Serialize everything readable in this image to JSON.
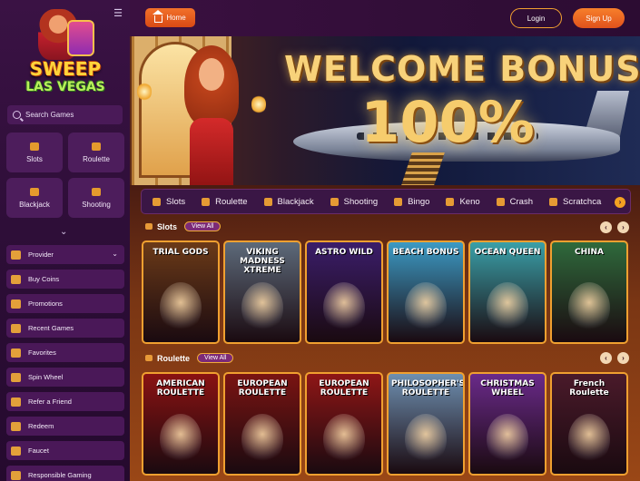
{
  "brand": {
    "line1": "SWEEP",
    "line2": "LAS VEGAS"
  },
  "sidebar": {
    "search_placeholder": "Search Games",
    "tiles": [
      {
        "label": "Slots",
        "icon": "slot-machine-icon"
      },
      {
        "label": "Roulette",
        "icon": "roulette-icon"
      },
      {
        "label": "Blackjack",
        "icon": "cards-icon"
      },
      {
        "label": "Shooting",
        "icon": "target-icon"
      }
    ],
    "nav": [
      {
        "label": "Provider",
        "icon": "provider-icon"
      },
      {
        "label": "Buy Coins",
        "icon": "coins-icon"
      },
      {
        "label": "Promotions",
        "icon": "gift-icon"
      },
      {
        "label": "Recent Games",
        "icon": "history-icon"
      },
      {
        "label": "Favorites",
        "icon": "star-icon"
      },
      {
        "label": "Spin Wheel",
        "icon": "wheel-icon"
      },
      {
        "label": "Refer a Friend",
        "icon": "users-icon"
      },
      {
        "label": "Redeem",
        "icon": "redeem-icon"
      },
      {
        "label": "Faucet",
        "icon": "faucet-icon"
      },
      {
        "label": "Responsible Gaming",
        "icon": "shield-icon"
      }
    ]
  },
  "header": {
    "home_label": "Home",
    "login_label": "Login",
    "signup_label": "Sign Up"
  },
  "banner": {
    "headline": "WELCOME BONUS",
    "percent": "100%"
  },
  "categories": [
    "Slots",
    "Roulette",
    "Blackjack",
    "Shooting",
    "Bingo",
    "Keno",
    "Crash",
    "Scratchca"
  ],
  "sections": {
    "slots": {
      "title": "Slots",
      "view_all": "View All",
      "games": [
        {
          "title": "TRIAL GODS",
          "bg": "#6b3a18"
        },
        {
          "title": "VIKING MADNESS XTREME",
          "bg": "#5d6a7a"
        },
        {
          "title": "ASTRO WILD",
          "bg": "#3b1d6a"
        },
        {
          "title": "BEACH BONUS",
          "bg": "#3c9ac4"
        },
        {
          "title": "OCEAN QUEEN",
          "bg": "#3aa0a8"
        },
        {
          "title": "CHINA",
          "bg": "#2f6a3c"
        }
      ]
    },
    "roulette": {
      "title": "Roulette",
      "view_all": "View All",
      "games": [
        {
          "title": "AMERICAN ROULETTE",
          "bg": "#8a1212"
        },
        {
          "title": "EUROPEAN ROULETTE",
          "bg": "#7a1412"
        },
        {
          "title": "EUROPEAN ROULETTE",
          "bg": "#8e1616"
        },
        {
          "title": "PHILOSOPHER'S ROULETTE",
          "bg": "#6e8fb0"
        },
        {
          "title": "CHRISTMAS WHEEL",
          "bg": "#6a2a8a"
        },
        {
          "title": "French Roulette",
          "bg": "#4a1a2a"
        }
      ]
    }
  }
}
